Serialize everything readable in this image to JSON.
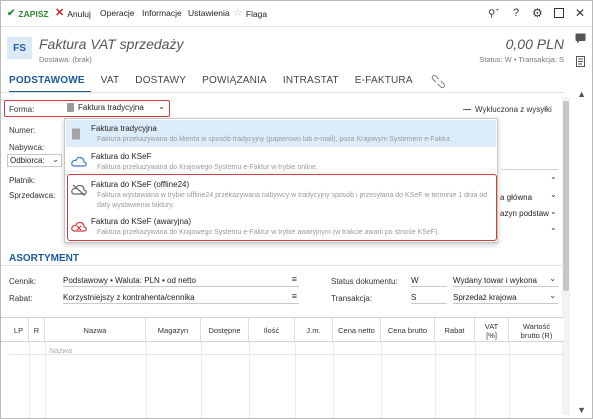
{
  "toolbar": {
    "save": "ZAPISZ",
    "cancel": "Anuluj",
    "operations": "Operacje",
    "information": "Informacje",
    "settings": "Ustawienia",
    "flag": "Flaga"
  },
  "header": {
    "badge": "FS",
    "title": "Faktura VAT sprzedaży",
    "subtitle": "Dostawa: (brak)",
    "amount": "0,00 PLN",
    "status": "Status: W • Transakcja: S"
  },
  "tabs": [
    "PODSTAWOWE",
    "VAT",
    "DOSTAWY",
    "POWIĄZANIA",
    "INTRASTAT",
    "E-FAKTURA"
  ],
  "form": {
    "forma_label": "Forma:",
    "forma_value": "Faktura tradycyjna",
    "excluded": "Wykluczona z wysyłki",
    "numer_label": "Numer:",
    "nabywca_label": "Nabywca:",
    "odbiorca_label": "Odbiorca:",
    "platnik_label": "Płatnik:",
    "sprzedawca_label": "Sprzedawca:",
    "right_field_1": "a główna",
    "right_field_2": "azyn podstaw"
  },
  "dropdown": {
    "options": [
      {
        "title": "Faktura tradycyjna",
        "desc": "Faktura przekazywana do klienta w sposób tradycyjny (papierowo lub e-mail), poza Krajowym Systemem e-Faktur."
      },
      {
        "title": "Faktura do KSeF",
        "desc": "Faktura przekazywana do Krajowego Systemu e-Faktur w trybie online."
      },
      {
        "title": "Faktura do KSeF (offline24)",
        "desc": "Faktura wystawiana w trybie offline24 przekazywana nabywcy w tradycyjny sposób i przesyłana do KSeF w terminie 1 dnia od daty wystawienia faktury."
      },
      {
        "title": "Faktura do KSeF (awaryjna)",
        "desc": "Faktura przekazywana do Krajowego Systemu e-Faktur w trybie awaryjnym (w trakcie awarii po stronie KSeF)."
      }
    ]
  },
  "assortment": {
    "title": "ASORTYMENT",
    "cennik_label": "Cennik:",
    "cennik_value": "Podstawowy • Waluta: PLN • od netto",
    "rabat_label": "Rabat:",
    "rabat_value": "Korzystniejszy z kontrahenta/cennika",
    "status_label": "Status dokumentu:",
    "status_code": "W",
    "status_value": "Wydany towar i wykona",
    "trans_label": "Transakcja:",
    "trans_code": "S",
    "trans_value": "Sprzedaż krajowa"
  },
  "table": {
    "columns": [
      "LP",
      "R",
      "Nazwa",
      "Magazyn",
      "Dostępne",
      "Ilość",
      "J.m.",
      "Cena netto",
      "Cena brutto",
      "Rabat",
      "VAT [%]",
      "Wartość brutto (R)"
    ],
    "name_placeholder": "Nazwa"
  },
  "colors": {
    "accent": "#1a5a9a",
    "highlight_border": "#d03a3a",
    "selected_option": "#ddecfa",
    "save_green": "#2e8b2e"
  }
}
